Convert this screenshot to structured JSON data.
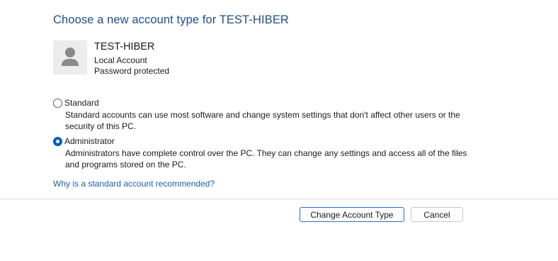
{
  "page": {
    "title": "Choose a new account type for TEST-HIBER"
  },
  "account": {
    "name": "TEST-HIBER",
    "type": "Local Account",
    "protection": "Password protected",
    "avatar_icon": "user-avatar-icon"
  },
  "options": {
    "standard": {
      "label": "Standard",
      "description_line1": "Standard accounts can use most software and change system settings that don't affect other users or the",
      "description_line2": "security of this PC.",
      "selected": false
    },
    "administrator": {
      "label": "Administrator",
      "description_line1": "Administrators have complete control over the PC. They can change any settings and access all of the files",
      "description_line2": "and programs stored on the PC.",
      "selected": true
    }
  },
  "help_link": "Why is a standard account recommended?",
  "buttons": {
    "change": "Change Account Type",
    "cancel": "Cancel"
  },
  "colors": {
    "title": "#1e4e8c",
    "link": "#1a5fa8",
    "radio_accent": "#005fb8"
  }
}
